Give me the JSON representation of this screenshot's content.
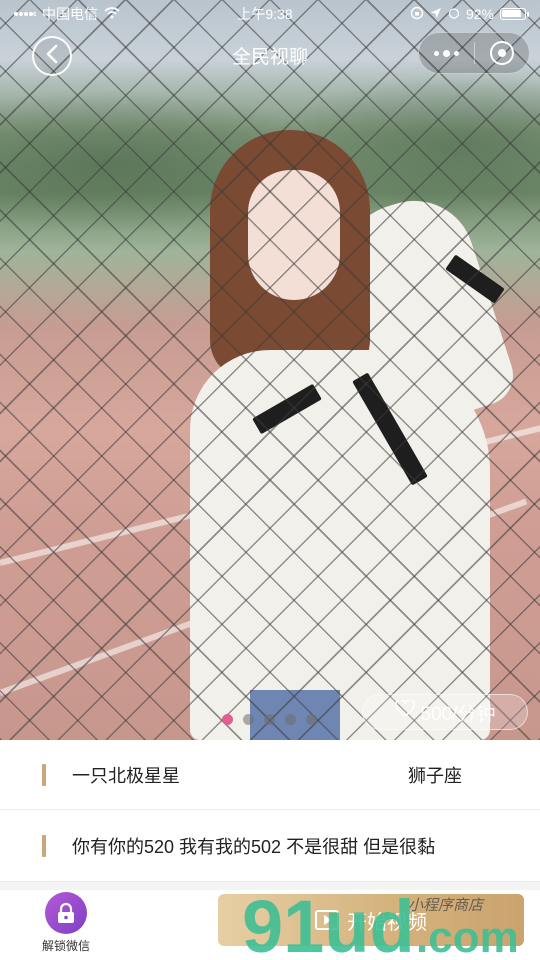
{
  "status_bar": {
    "carrier": "中国电信",
    "time": "上午9:38",
    "battery_percent": "92%",
    "battery_level": 0.92
  },
  "nav": {
    "title": "全民视聊"
  },
  "hero": {
    "slide_count": 5,
    "active_slide": 0,
    "price_text": "500/分钟"
  },
  "profile": {
    "nickname": "一只北极星星",
    "zodiac": "狮子座",
    "motto": "你有你的520 我有我的502 不是很甜 但是很黏"
  },
  "bottom_bar": {
    "unlock_label": "解锁微信",
    "start_video_label": "开始视频"
  },
  "watermark": {
    "logo": "91ud",
    "domain": ".com",
    "tagline": "小程序商店"
  },
  "colors": {
    "accent_gold": "#c9a77a",
    "indicator_active": "#e35d8f",
    "unlock_purple": "#9b4fd0",
    "watermark_green": "#3fbf95"
  }
}
